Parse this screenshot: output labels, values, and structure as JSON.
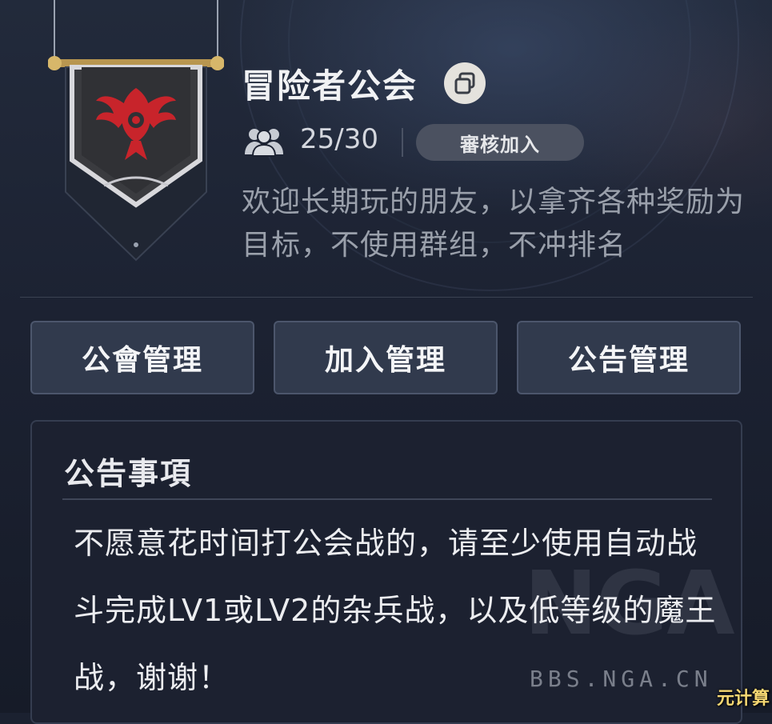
{
  "guild": {
    "name": "冒险者公会",
    "members": "25/30",
    "join_mode": "審核加入",
    "description": "欢迎长期玩的朋友，以拿齐各种奖励为目标，不使用群组，不冲排名",
    "emblem_icon": "red-phoenix-banner-icon",
    "copy_icon": "copy-icon",
    "members_icon": "members-icon"
  },
  "management": {
    "guild_label": "公會管理",
    "join_label": "加入管理",
    "notice_label": "公告管理"
  },
  "notice": {
    "title": "公告事項",
    "body": "不愿意花时间打公会战的，请至少使用自动战斗完成LV1或LV2的杂兵战，以及低等级的魔王战，谢谢！"
  },
  "watermark": {
    "logo": "NGA",
    "url": "BBS.NGA.CN",
    "corner": "元计算"
  },
  "colors": {
    "background": "#1b2130",
    "button": "#313a4d",
    "badge": "#4b5160",
    "emblem_red": "#c8242b"
  }
}
